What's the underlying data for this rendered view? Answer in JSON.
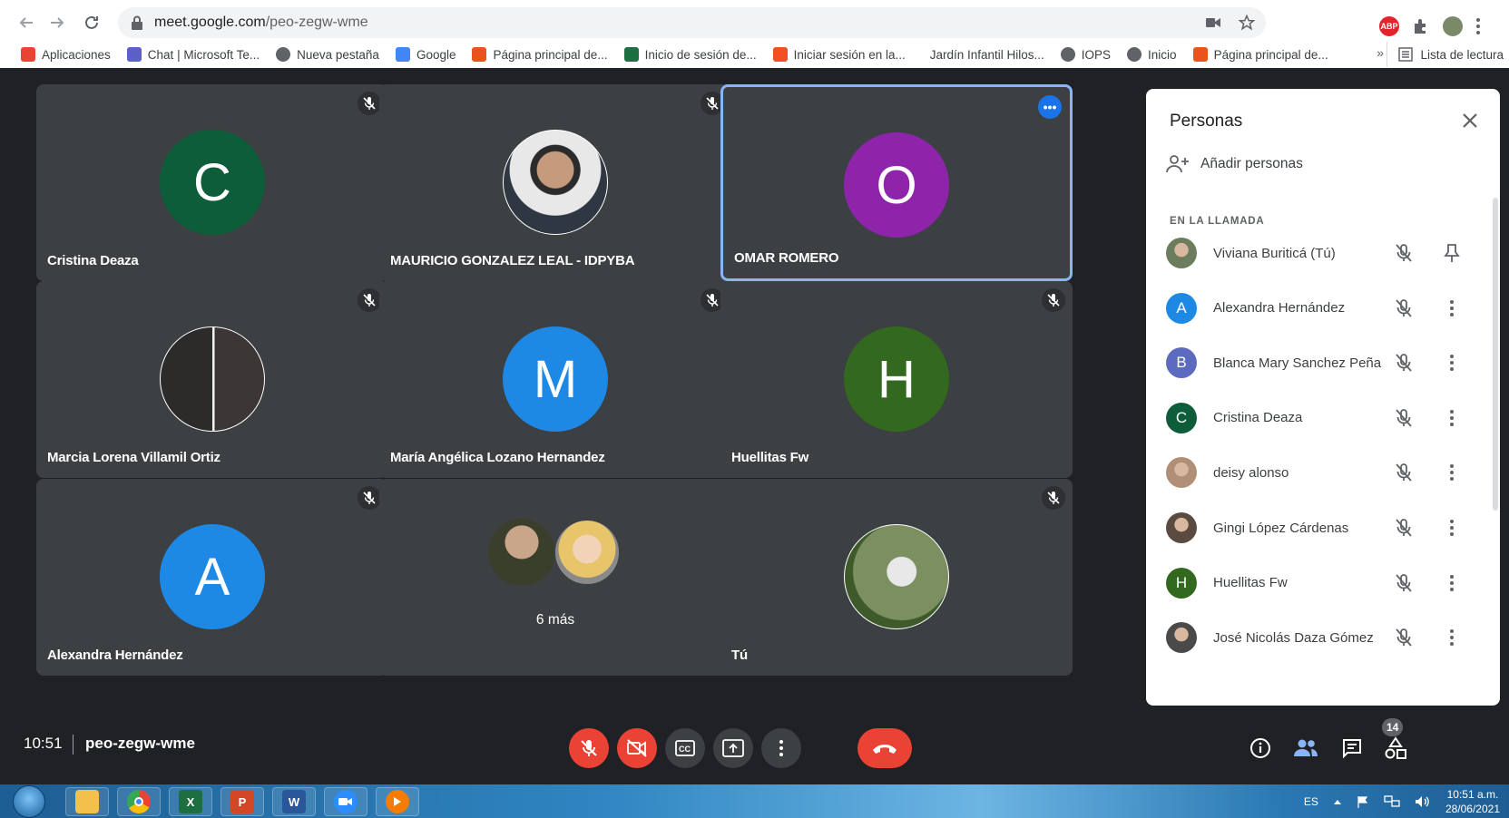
{
  "browser": {
    "url_host": "meet.google.com",
    "url_path": "/peo-zegw-wme",
    "bookmarks": [
      {
        "label": "Aplicaciones",
        "icon": "apps-grid-icon",
        "color": "#ea4335"
      },
      {
        "label": "Chat | Microsoft Te...",
        "icon": "teams-icon",
        "color": "#5b5fc7"
      },
      {
        "label": "Nueva pestaña",
        "icon": "globe-icon",
        "color": "#5f6368"
      },
      {
        "label": "Google",
        "icon": "google-icon",
        "color": "#4285f4"
      },
      {
        "label": "Página principal de...",
        "icon": "office-icon",
        "color": "#e8541c"
      },
      {
        "label": "Inicio de sesión de...",
        "icon": "sheet-icon",
        "color": "#1d6f42"
      },
      {
        "label": "Iniciar sesión en la...",
        "icon": "microsoft-icon",
        "color": "#f25022"
      },
      {
        "label": "Jardín Infantil Hilos...",
        "icon": "blank-icon",
        "color": "#ffffff"
      },
      {
        "label": "IOPS",
        "icon": "globe-icon",
        "color": "#5f6368"
      },
      {
        "label": "Inicio",
        "icon": "globe-icon",
        "color": "#5f6368"
      },
      {
        "label": "Página principal de...",
        "icon": "office-icon",
        "color": "#e8541c"
      }
    ],
    "more_bookmarks": "»",
    "reading_list": "Lista de lectura"
  },
  "tiles": [
    {
      "name": "Cristina Deaza",
      "initial": "C",
      "color": "#0d5c3a",
      "photo": false,
      "muted": true,
      "active": false
    },
    {
      "name": "MAURICIO GONZALEZ LEAL - IDPYBA",
      "initial": "",
      "color": "#9aa0a6",
      "photo": true,
      "muted": true,
      "active": false
    },
    {
      "name": "OMAR ROMERO",
      "initial": "O",
      "color": "#8e24aa",
      "photo": false,
      "muted": false,
      "active": true
    },
    {
      "name": "Marcia Lorena Villamil Ortiz",
      "initial": "",
      "color": "#5f6368",
      "photo": true,
      "muted": true,
      "active": false
    },
    {
      "name": "María Angélica Lozano Hernandez",
      "initial": "M",
      "color": "#1e88e5",
      "photo": false,
      "muted": true,
      "active": false
    },
    {
      "name": "Huellitas Fw",
      "initial": "H",
      "color": "#33691e",
      "photo": false,
      "muted": true,
      "active": false
    },
    {
      "name": "Alexandra Hernández",
      "initial": "A",
      "color": "#1e88e5",
      "photo": false,
      "muted": true,
      "active": false
    },
    {
      "name": "",
      "initial": "",
      "color": "#3c4043",
      "photo": false,
      "muted": false,
      "active": false
    },
    {
      "name": "Tú",
      "initial": "",
      "color": "#6d8a55",
      "photo": true,
      "muted": true,
      "active": false
    }
  ],
  "more_tile": {
    "label": "6 más"
  },
  "people_panel": {
    "title": "Personas",
    "add_people": "Añadir personas",
    "section": "EN LA LLAMADA",
    "participants": [
      {
        "name": "Viviana Buriticá (Tú)",
        "initial": "",
        "color": "#6b7d5c",
        "photo": true,
        "action": "pin-icon"
      },
      {
        "name": "Alexandra Hernández",
        "initial": "A",
        "color": "#1e88e5",
        "photo": false,
        "action": "more-vert-icon"
      },
      {
        "name": "Blanca Mary Sanchez Peña",
        "initial": "B",
        "color": "#5c6bc0",
        "photo": false,
        "action": "more-vert-icon"
      },
      {
        "name": "Cristina Deaza",
        "initial": "C",
        "color": "#0d5c3a",
        "photo": false,
        "action": "more-vert-icon"
      },
      {
        "name": "deisy alonso",
        "initial": "",
        "color": "#b08f76",
        "photo": true,
        "action": "more-vert-icon"
      },
      {
        "name": "Gingi López Cárdenas",
        "initial": "",
        "color": "#5b4a3f",
        "photo": true,
        "action": "more-vert-icon"
      },
      {
        "name": "Huellitas Fw",
        "initial": "H",
        "color": "#33691e",
        "photo": false,
        "action": "more-vert-icon"
      },
      {
        "name": "José Nicolás Daza Gómez",
        "initial": "",
        "color": "#4a4a4a",
        "photo": true,
        "action": "more-vert-icon"
      }
    ]
  },
  "bottom_bar": {
    "time": "10:51",
    "meeting_code": "peo-zegw-wme",
    "participant_count": "14"
  },
  "taskbar": {
    "language": "ES",
    "time": "10:51 a.m.",
    "date": "28/06/2021",
    "apps": [
      {
        "name": "file-explorer-icon",
        "letter": "",
        "color": "#f3c14b"
      },
      {
        "name": "chrome-icon",
        "letter": "",
        "color": "#ffffff"
      },
      {
        "name": "excel-icon",
        "letter": "X",
        "color": "#1d6f42"
      },
      {
        "name": "powerpoint-icon",
        "letter": "P",
        "color": "#d24726"
      },
      {
        "name": "word-icon",
        "letter": "W",
        "color": "#2b579a"
      },
      {
        "name": "zoom-icon",
        "letter": "",
        "color": "#2d8cff"
      },
      {
        "name": "media-player-icon",
        "letter": "",
        "color": "#f57c00"
      }
    ]
  }
}
